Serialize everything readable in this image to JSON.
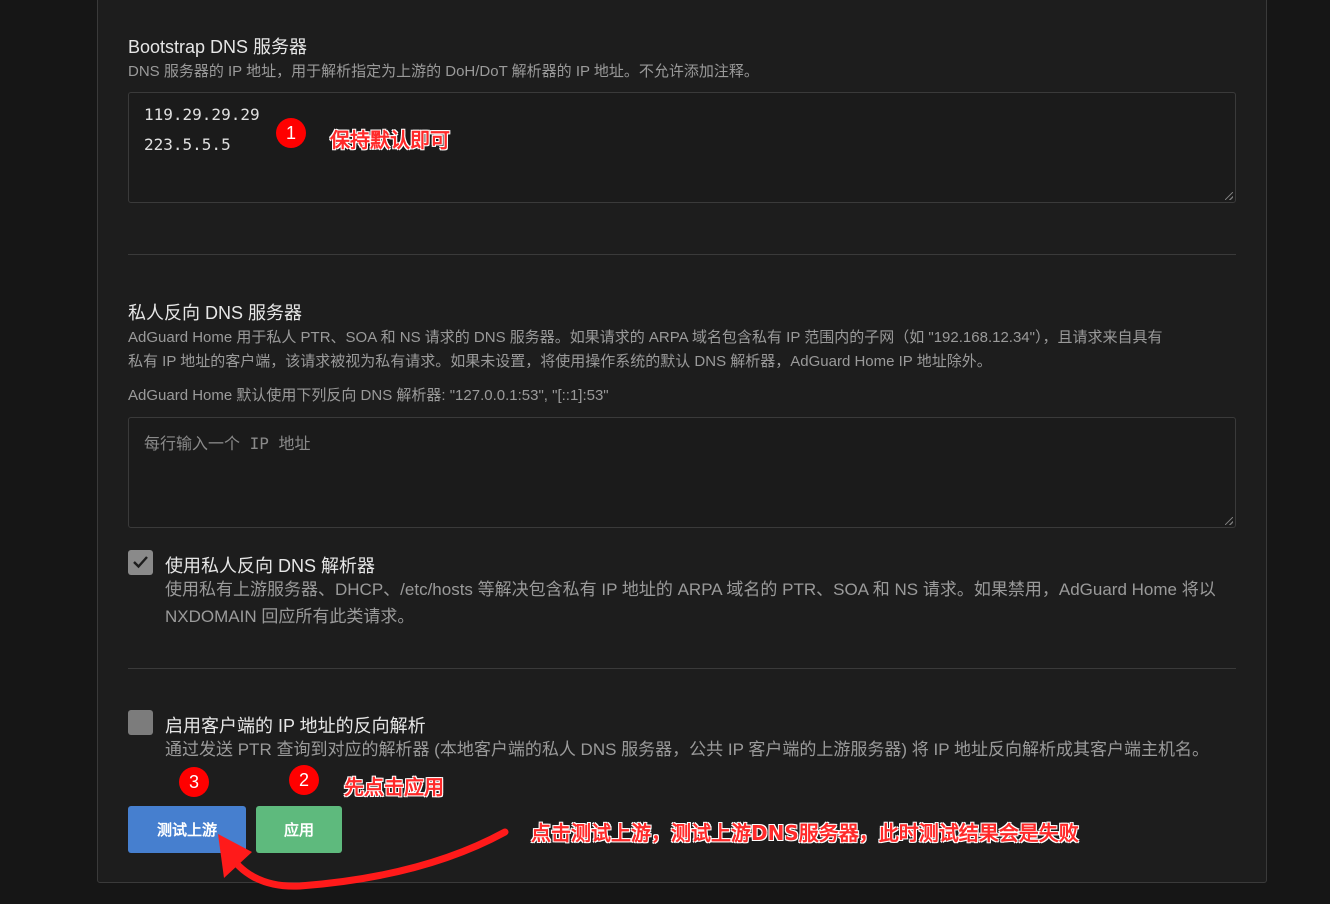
{
  "bootstrap": {
    "title": "Bootstrap DNS 服务器",
    "desc": "DNS 服务器的 IP 地址，用于解析指定为上游的 DoH/DoT 解析器的 IP 地址。不允许添加注释。",
    "lines": [
      "119.29.29.29",
      "223.5.5.5"
    ]
  },
  "private_dns": {
    "title": "私人反向 DNS 服务器",
    "desc_line1": "AdGuard Home 用于私人 PTR、SOA 和 NS 请求的 DNS 服务器。如果请求的 ARPA 域名包含私有 IP 范围内的子网（如 \"192.168.12.34\"），且请求来自具有",
    "desc_line2": "私有 IP 地址的客户端，该请求被视为私有请求。如果未设置，将使用操作系统的默认 DNS 解析器，AdGuard Home IP 地址除外。",
    "default_note": "AdGuard Home 默认使用下列反向 DNS 解析器: \"127.0.0.1:53\", \"[::1]:53\"",
    "placeholder": "每行输入一个 IP 地址"
  },
  "use_private": {
    "label": "使用私人反向 DNS 解析器",
    "checked": true,
    "desc_line1": "使用私有上游服务器、DHCP、/etc/hosts 等解决包含私有 IP 地址的 ARPA 域名的 PTR、SOA 和 NS 请求。如果禁用，AdGuard Home 将以",
    "desc_line2": "NXDOMAIN 回应所有此类请求。"
  },
  "client_rdns": {
    "label": "启用客户端的 IP 地址的反向解析",
    "checked": false,
    "desc": "通过发送 PTR 查询到对应的解析器 (本地客户端的私人 DNS 服务器，公共 IP 客户端的上游服务器) 将 IP 地址反向解析成其客户端主机名。"
  },
  "buttons": {
    "test_upstream": "测试上游",
    "apply": "应用"
  },
  "annotations": {
    "badge1": "1",
    "note1": "保持默认即可",
    "badge2": "2",
    "note2": "先点击应用",
    "badge3": "3",
    "note3": "点击测试上游，测试上游DNS服务器，此时测试结果会是失败"
  },
  "colors": {
    "accent_blue": "#467fcf",
    "accent_green": "#5eba7d",
    "annotation_red": "#ff0000"
  }
}
